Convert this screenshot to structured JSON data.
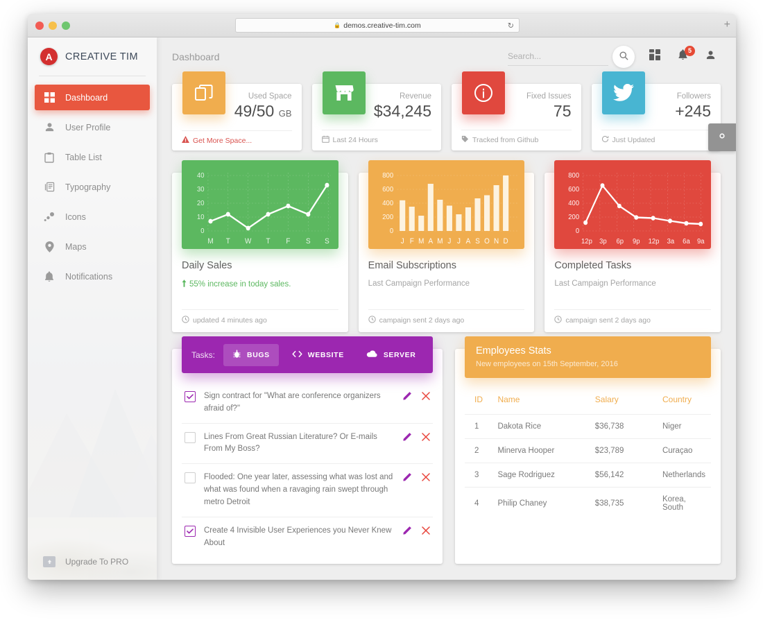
{
  "browser": {
    "url": "demos.creative-tim.com",
    "lock_icon": "lock-icon",
    "reload_icon": "reload-icon",
    "new_tab_label": "+"
  },
  "sidebar": {
    "brand": "CREATIVE TIM",
    "brand_mark": "angular-logo-icon",
    "items": [
      {
        "label": "Dashboard",
        "icon": "dashboard-grid-icon",
        "active": true
      },
      {
        "label": "User Profile",
        "icon": "person-icon",
        "active": false
      },
      {
        "label": "Table List",
        "icon": "clipboard-icon",
        "active": false
      },
      {
        "label": "Typography",
        "icon": "article-icon",
        "active": false
      },
      {
        "label": "Icons",
        "icon": "bubbles-icon",
        "active": false
      },
      {
        "label": "Maps",
        "icon": "map-pin-icon",
        "active": false
      },
      {
        "label": "Notifications",
        "icon": "bell-icon",
        "active": false
      }
    ],
    "upgrade": {
      "label": "Upgrade To PRO",
      "icon": "cloud-upload-icon"
    }
  },
  "topbar": {
    "title": "Dashboard",
    "search_placeholder": "Search...",
    "search_value": "",
    "search_icon": "search-icon",
    "apps_icon": "apps-grid-icon",
    "notifications_icon": "bell-icon",
    "notifications_badge": "5",
    "account_icon": "person-icon"
  },
  "settings_button": {
    "icon": "gear-icon"
  },
  "stats": [
    {
      "icon": "copy-icon",
      "color": "#f0ad4e",
      "label": "Used Space",
      "value": "49/50",
      "unit": "GB",
      "footer": "Get More Space...",
      "footer_icon": "warning-icon",
      "footer_danger": true
    },
    {
      "icon": "store-icon",
      "color": "#5cb860",
      "label": "Revenue",
      "value": "$34,245",
      "unit": "",
      "footer": "Last 24 Hours",
      "footer_icon": "calendar-icon",
      "footer_danger": false
    },
    {
      "icon": "info-icon",
      "color": "#e0483e",
      "label": "Fixed Issues",
      "value": "75",
      "unit": "",
      "footer": "Tracked from Github",
      "footer_icon": "tag-icon",
      "footer_danger": false
    },
    {
      "icon": "twitter-icon",
      "color": "#48b5d2",
      "label": "Followers",
      "value": "+245",
      "unit": "",
      "footer": "Just Updated",
      "footer_icon": "refresh-icon",
      "footer_danger": false
    }
  ],
  "chart_cards": [
    {
      "title": "Daily Sales",
      "subtitle": "55% increase in today sales.",
      "subtitle_icon": "arrow-up-icon",
      "subtitle_highlight": true,
      "footer": "updated 4 minutes ago",
      "footer_icon": "clock-icon",
      "color": "#5cb860"
    },
    {
      "title": "Email Subscriptions",
      "subtitle": "Last Campaign Performance",
      "subtitle_icon": "",
      "subtitle_highlight": false,
      "footer": "campaign sent 2 days ago",
      "footer_icon": "clock-icon",
      "color": "#f0ad4e"
    },
    {
      "title": "Completed Tasks",
      "subtitle": "Last Campaign Performance",
      "subtitle_icon": "",
      "subtitle_highlight": false,
      "footer": "campaign sent 2 days ago",
      "footer_icon": "clock-icon",
      "color": "#e0483e"
    }
  ],
  "chart_data": [
    {
      "type": "line",
      "title": "Daily Sales",
      "categories": [
        "M",
        "T",
        "W",
        "T",
        "F",
        "S",
        "S"
      ],
      "values": [
        7,
        12,
        2,
        12,
        18,
        12,
        33
      ],
      "yticks": [
        0,
        10,
        20,
        30,
        40
      ],
      "ylim": [
        0,
        45
      ],
      "xlabel": "",
      "ylabel": "",
      "grid": true,
      "legend": "none",
      "series_color": "#ffffff",
      "background": "#5cb860"
    },
    {
      "type": "bar",
      "title": "Email Subscriptions",
      "categories": [
        "J",
        "F",
        "M",
        "A",
        "M",
        "J",
        "J",
        "A",
        "S",
        "O",
        "N",
        "D"
      ],
      "values": [
        442,
        350,
        220,
        680,
        450,
        365,
        240,
        340,
        470,
        515,
        660,
        800
      ],
      "yticks": [
        0,
        200,
        400,
        600,
        800
      ],
      "ylim": [
        0,
        880
      ],
      "xlabel": "",
      "ylabel": "",
      "grid": true,
      "legend": "none",
      "series_color": "#fdf3e0",
      "background": "#f0ad4e"
    },
    {
      "type": "line",
      "title": "Completed Tasks",
      "categories": [
        "12p",
        "3p",
        "6p",
        "9p",
        "12p",
        "3a",
        "6a",
        "9a"
      ],
      "values": [
        120,
        655,
        360,
        195,
        185,
        145,
        110,
        100
      ],
      "yticks": [
        0,
        200,
        400,
        600,
        800
      ],
      "ylim": [
        0,
        880
      ],
      "xlabel": "",
      "ylabel": "",
      "grid": true,
      "legend": "none",
      "series_color": "#ffffff",
      "background": "#e0483e"
    }
  ],
  "tasks_panel": {
    "label": "Tasks:",
    "tabs": [
      {
        "label": "BUGS",
        "icon": "bug-icon",
        "active": true
      },
      {
        "label": "WEBSITE",
        "icon": "code-icon",
        "active": false
      },
      {
        "label": "SERVER",
        "icon": "cloud-icon",
        "active": false
      }
    ],
    "edit_icon": "pencil-icon",
    "delete_icon": "close-x-icon",
    "items": [
      {
        "text": "Sign contract for \"What are conference organizers afraid of?\"",
        "checked": true
      },
      {
        "text": "Lines From Great Russian Literature? Or E-mails From My Boss?",
        "checked": false
      },
      {
        "text": "Flooded: One year later, assessing what was lost and what was found when a ravaging rain swept through metro Detroit",
        "checked": false
      },
      {
        "text": "Create 4 Invisible User Experiences you Never Knew About",
        "checked": true
      }
    ]
  },
  "employees_panel": {
    "title": "Employees Stats",
    "subtitle": "New employees on 15th September, 2016",
    "columns": [
      "ID",
      "Name",
      "Salary",
      "Country"
    ],
    "rows": [
      {
        "id": "1",
        "name": "Dakota Rice",
        "salary": "$36,738",
        "country": "Niger"
      },
      {
        "id": "2",
        "name": "Minerva Hooper",
        "salary": "$23,789",
        "country": "Curaçao"
      },
      {
        "id": "3",
        "name": "Sage Rodriguez",
        "salary": "$56,142",
        "country": "Netherlands"
      },
      {
        "id": "4",
        "name": "Philip Chaney",
        "salary": "$38,735",
        "country": "Korea, South"
      }
    ]
  }
}
